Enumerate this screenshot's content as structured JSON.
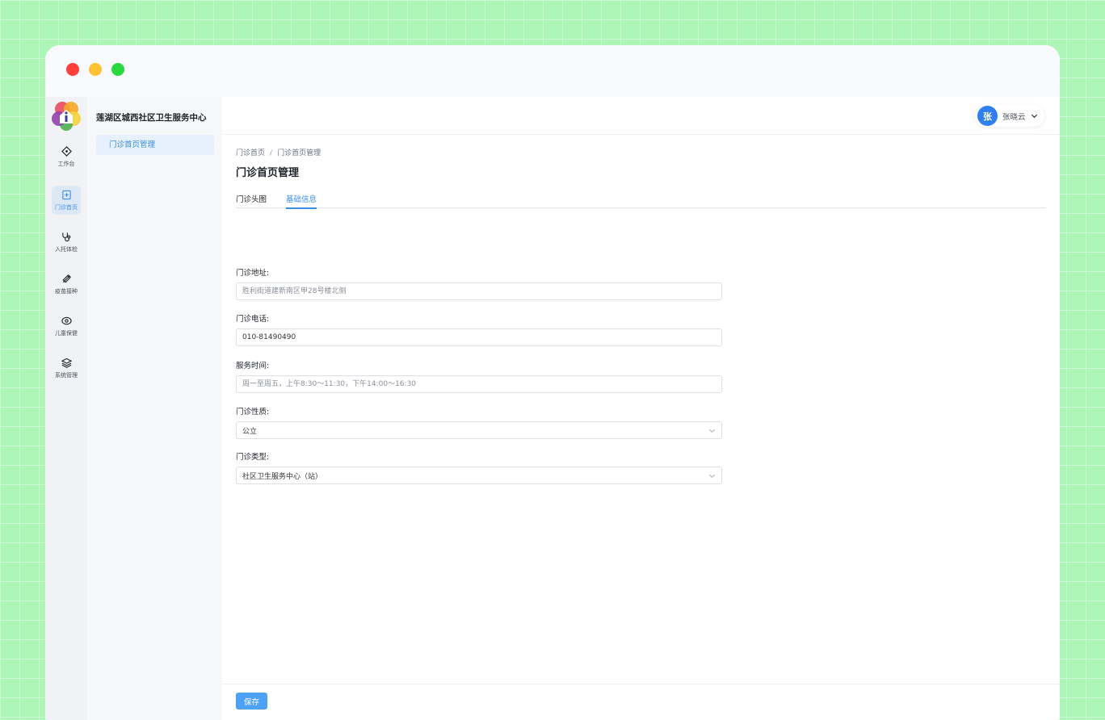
{
  "window": {
    "controls": [
      "close",
      "minimize",
      "zoom"
    ]
  },
  "rail": {
    "items": [
      {
        "label": "工作台",
        "icon": "workbench-icon",
        "active": false
      },
      {
        "label": "门诊首页",
        "icon": "clinic-home-icon",
        "active": true
      },
      {
        "label": "入托体检",
        "icon": "stethoscope-icon",
        "active": false
      },
      {
        "label": "疫苗接种",
        "icon": "syringe-icon",
        "active": false
      },
      {
        "label": "儿童保健",
        "icon": "child-care-icon",
        "active": false
      },
      {
        "label": "系统管理",
        "icon": "layers-icon",
        "active": false
      }
    ]
  },
  "subnav": {
    "org_name": "莲湖区城西社区卫生服务中心",
    "items": [
      {
        "label": "门诊首页管理",
        "active": true
      }
    ]
  },
  "header": {
    "user": {
      "avatar_text": "张",
      "name": "张晓云"
    }
  },
  "breadcrumb": {
    "items": [
      "门诊首页",
      "门诊首页管理"
    ],
    "separator": "/"
  },
  "page": {
    "title": "门诊首页管理"
  },
  "tabs": [
    {
      "label": "门诊头图",
      "active": false
    },
    {
      "label": "基础信息",
      "active": true
    }
  ],
  "form": {
    "address": {
      "label": "门诊地址:",
      "value": "",
      "placeholder": "胜利街道建新南区甲28号楼北侧"
    },
    "phone": {
      "label": "门诊电话:",
      "value": "010-81490490",
      "placeholder": ""
    },
    "hours": {
      "label": "服务时间:",
      "value": "",
      "placeholder": "周一至周五，上午8:30～11:30，下午14:00～16:30"
    },
    "nature": {
      "label": "门诊性质:",
      "selected": "公立"
    },
    "type": {
      "label": "门诊类型:",
      "selected": "社区卫生服务中心（站）"
    }
  },
  "footer": {
    "save_label": "保存"
  },
  "colors": {
    "accent": "#3a8ee6",
    "avatar": "#2f7ff0",
    "save_button": "#4ea2f5",
    "background": "#aef5b8"
  }
}
